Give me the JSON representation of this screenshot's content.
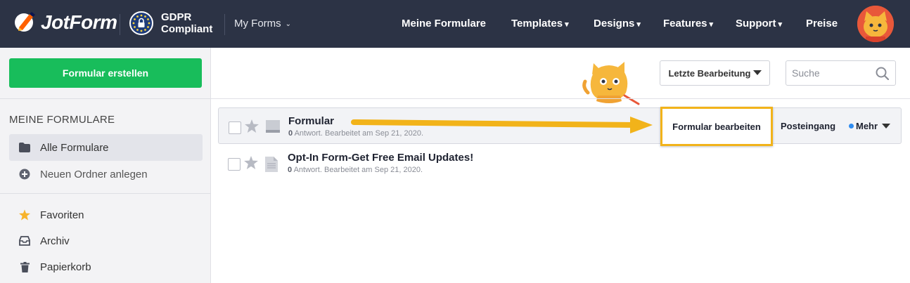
{
  "header": {
    "brand": "JotForm",
    "gdpr_line1": "GDPR",
    "gdpr_line2": "Compliant",
    "my_forms": "My Forms",
    "nav": [
      {
        "label": "Meine Formulare",
        "dropdown": false
      },
      {
        "label": "Templates",
        "dropdown": true
      },
      {
        "label": "Designs",
        "dropdown": true
      },
      {
        "label": "Features",
        "dropdown": true
      },
      {
        "label": "Support",
        "dropdown": true
      },
      {
        "label": "Preise",
        "dropdown": false
      }
    ],
    "caret": "▾",
    "chevron": "⌄"
  },
  "sidebar": {
    "create_button": "Formular erstellen",
    "section_title": "MEINE FORMULARE",
    "items": [
      {
        "label": "Alle Formulare",
        "icon": "folder-icon",
        "active": true
      },
      {
        "label": "Neuen Ordner anlegen",
        "icon": "plus-circle-icon",
        "active": false
      },
      {
        "label": "Favoriten",
        "icon": "star-icon",
        "active": false
      },
      {
        "label": "Archiv",
        "icon": "archive-icon",
        "active": false
      },
      {
        "label": "Papierkorb",
        "icon": "trash-icon",
        "active": false
      }
    ]
  },
  "toolbar": {
    "sort_label": "Letzte Bearbeitung",
    "search_placeholder": "Suche"
  },
  "forms": [
    {
      "title": "Formular",
      "responses": "0",
      "meta": " Antwort. Bearbeitet am Sep 21, 2020.",
      "selected": true,
      "actions": {
        "edit": "Formular bearbeiten",
        "inbox": "Posteingang",
        "more": "Mehr"
      }
    },
    {
      "title": "Opt-In Form-Get Free Email Updates!",
      "responses": "0",
      "meta": " Antwort. Bearbeitet am Sep 21, 2020.",
      "selected": false
    }
  ],
  "colors": {
    "topbar": "#2c3345",
    "create_button": "#18bd5b",
    "highlight": "#f2b31a",
    "dot": "#2f8cf0"
  }
}
